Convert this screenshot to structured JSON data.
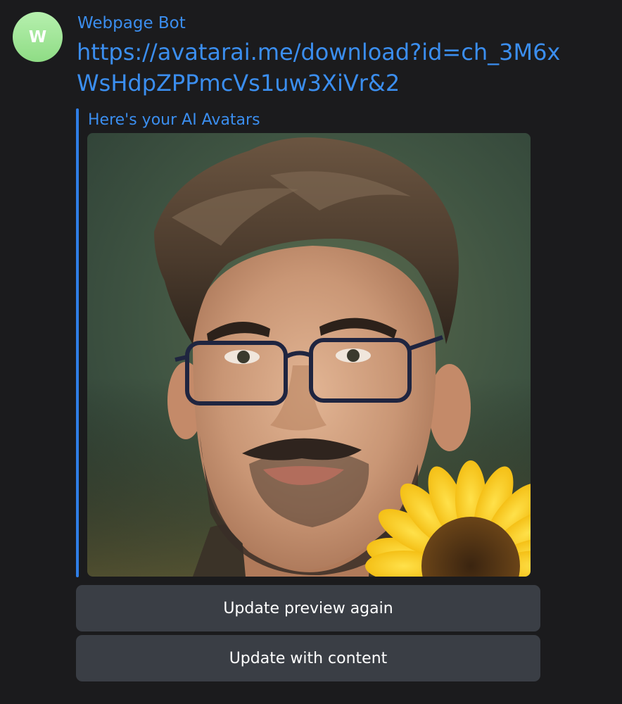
{
  "message": {
    "avatar_initial": "W",
    "sender": "Webpage Bot",
    "link_text": "https://avatarai.me/download?id=ch_3M6xWsHdpZPPmcVs1uw3XiVr&2"
  },
  "link_preview": {
    "title": "Here's your AI Avatars",
    "image_description": "portrait-with-sunflower"
  },
  "buttons": {
    "update_preview_again": "Update preview again",
    "update_with_content": "Update with content"
  },
  "colors": {
    "background": "#1b1b1d",
    "accent": "#3b8eef",
    "button_bg": "#3a3e45",
    "avatar_green": "#9fe496"
  }
}
